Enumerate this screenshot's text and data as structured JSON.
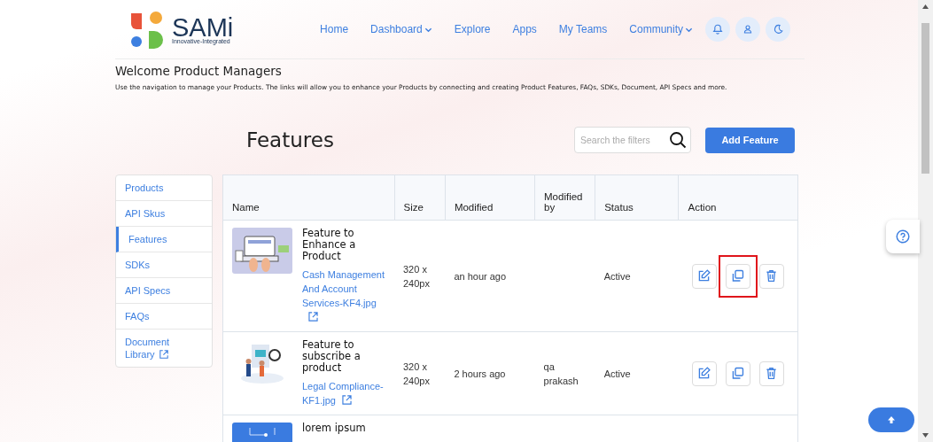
{
  "header": {
    "logo_text": "SAMi",
    "logo_tagline": "Innovative-Integrated",
    "nav": [
      {
        "label": "Home",
        "has_menu": false
      },
      {
        "label": "Dashboard",
        "has_menu": true
      },
      {
        "label": "Explore",
        "has_menu": false
      },
      {
        "label": "Apps",
        "has_menu": false
      },
      {
        "label": "My Teams",
        "has_menu": false
      },
      {
        "label": "Community",
        "has_menu": true
      }
    ],
    "icon_buttons": [
      {
        "kind": "bell"
      },
      {
        "kind": "user"
      },
      {
        "kind": "moon"
      }
    ]
  },
  "welcome": {
    "title": "Welcome Product Managers",
    "text": "Use the navigation to manage your Products. The links will allow you to enhance your Products by connecting and creating Product Features, FAQs, SDKs, Document, API Specs and more."
  },
  "page_title": "Features",
  "search": {
    "placeholder": "Search the filters"
  },
  "add_button": "Add Feature",
  "sidebar": {
    "items": [
      {
        "label": "Products",
        "selected": false,
        "external": false
      },
      {
        "label": "API Skus",
        "selected": false,
        "external": false
      },
      {
        "label": "Features",
        "selected": true,
        "external": false
      },
      {
        "label": "SDKs",
        "selected": false,
        "external": false
      },
      {
        "label": "API Specs",
        "selected": false,
        "external": false
      },
      {
        "label": "FAQs",
        "selected": false,
        "external": false
      },
      {
        "label": "Document Library",
        "selected": false,
        "external": true
      }
    ]
  },
  "table": {
    "columns": [
      "Name",
      "Size",
      "Modified",
      "Modified by",
      "Status",
      "Action"
    ],
    "rows": [
      {
        "name": "Feature to Enhance a Product",
        "file": "Cash Management And Account Services-KF4.jpg",
        "size": "320 x 240px",
        "modified": "an hour ago",
        "status": "Active",
        "actions": [
          {
            "kind": "edit",
            "highlighted": false
          },
          {
            "kind": "copy",
            "highlighted": true
          },
          {
            "kind": "delete",
            "highlighted": false
          }
        ]
      },
      {
        "name": "Feature to subscribe a product",
        "file": "Legal Compliance-KF1.jpg",
        "size": "320 x 240px",
        "modified": "2 hours ago",
        "modified_by": "qa prakash",
        "status": "Active",
        "actions": [
          {
            "kind": "edit",
            "highlighted": false
          },
          {
            "kind": "copy",
            "highlighted": false
          },
          {
            "kind": "delete",
            "highlighted": false
          }
        ]
      },
      {
        "name": "lorem ipsum"
      }
    ]
  }
}
